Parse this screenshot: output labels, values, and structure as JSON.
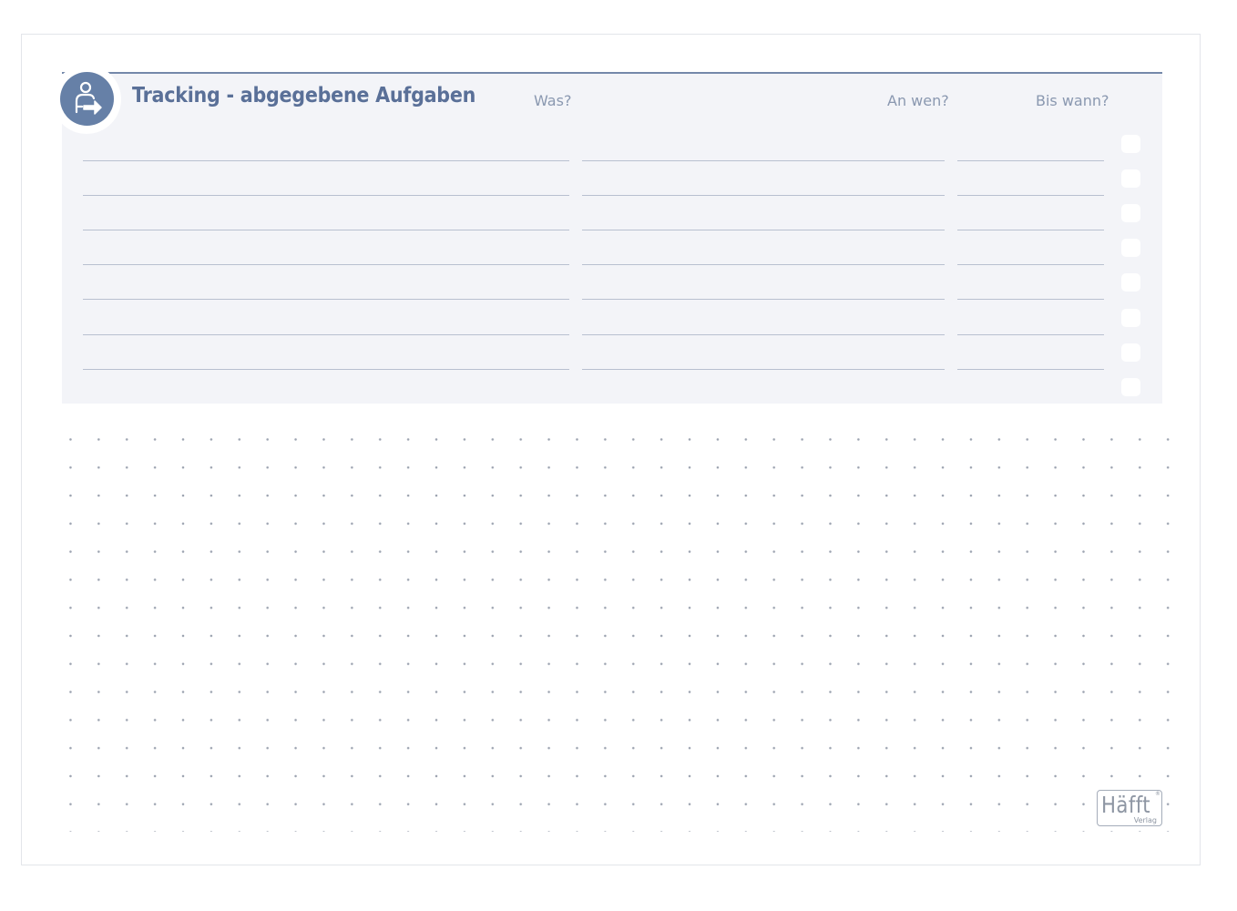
{
  "header": {
    "title": "Tracking - abgegebene Aufgaben",
    "icon": "person-handover-icon"
  },
  "columns": {
    "was": "Was?",
    "an_wen": "An wen?",
    "bis_wann": "Bis wann?"
  },
  "form": {
    "row_count": 7,
    "checkbox_count": 8
  },
  "logo": {
    "name": "Häfft",
    "sub": "Verlag",
    "mark": "®"
  },
  "colors": {
    "accent": "#6680a7",
    "panel": "#f3f4f8",
    "rule": "#b8c0d0",
    "dot": "#9ca3b0"
  }
}
